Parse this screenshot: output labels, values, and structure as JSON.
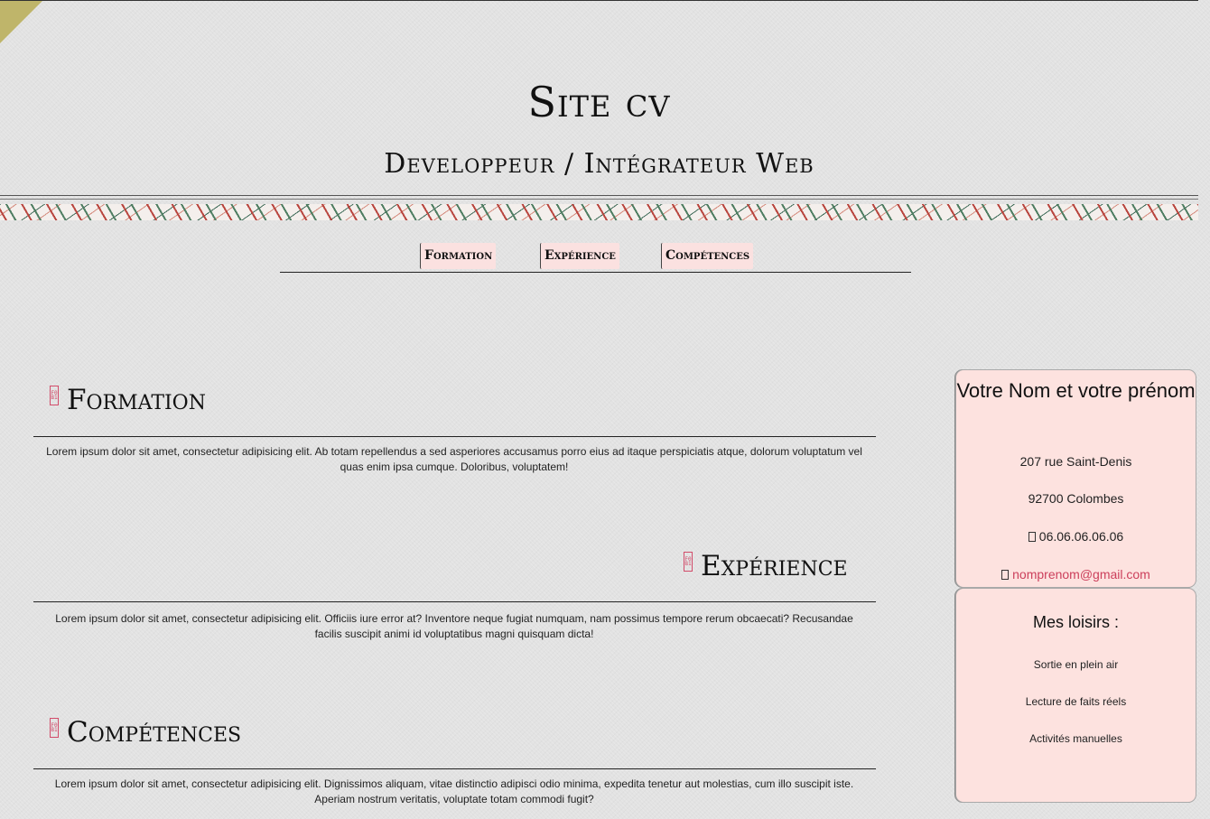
{
  "header": {
    "title": "Site cv",
    "subtitle": "Developpeur / Intégrateur Web"
  },
  "nav": {
    "items": [
      {
        "label": "Formation"
      },
      {
        "label": "Expérience"
      },
      {
        "label": "Compétences"
      }
    ]
  },
  "sections": [
    {
      "title": "Formation",
      "text": "Lorem ipsum dolor sit amet, consectetur adipisicing elit. Ab totam repellendus a sed asperiores accusamus porro eius ad itaque perspiciatis atque, dolorum voluptatum vel quas enim ipsa cumque. Doloribus, voluptatem!"
    },
    {
      "title": "Expérience",
      "text": "Lorem ipsum dolor sit amet, consectetur adipisicing elit. Officiis iure error at? Inventore neque fugiat numquam, nam possimus tempore rerum obcaecati? Recusandae facilis suscipit animi id voluptatibus magni quisquam dicta!"
    },
    {
      "title": "Compétences",
      "text": "Lorem ipsum dolor sit amet, consectetur adipisicing elit. Dignissimos aliquam, vitae distinctio adipisci odio minima, expedita tenetur aut molestias, cum illo suscipit iste. Aperiam nostrum veritatis, voluptate totam commodi fugit?"
    }
  ],
  "contact": {
    "name": "Votre Nom et votre prénom",
    "street": "207 rue Saint-Denis",
    "city": "92700 Colombes",
    "phone": "06.06.06.06.06",
    "email": "nomprenom@gmail.com"
  },
  "hobbies": {
    "title": "Mes loisirs :",
    "items": [
      "Sortie en plein air",
      "Lecture de faits réels",
      "Activités manuelles"
    ]
  },
  "colors": {
    "accent_pink": "#fde2df",
    "link": "#cc3f5b",
    "corner": "#bfb56a"
  }
}
